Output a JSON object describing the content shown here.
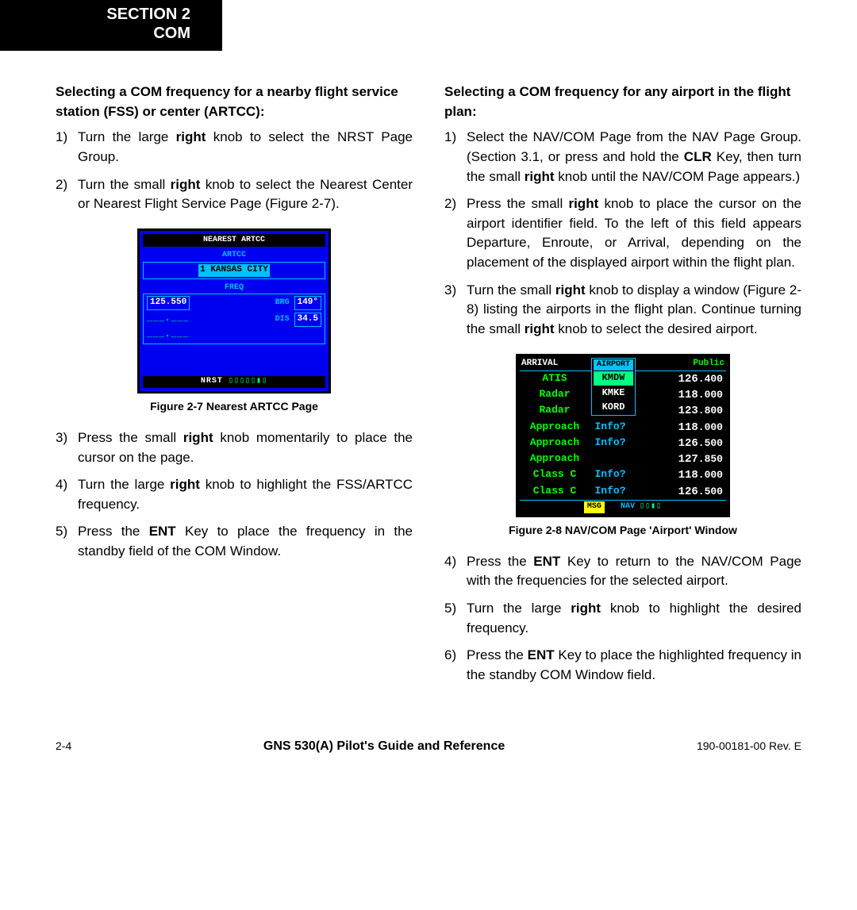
{
  "header": {
    "line1": "SECTION 2",
    "line2": "COM"
  },
  "left": {
    "heading": "Selecting a COM frequency for a nearby flight service station (FSS) or center (ARTCC):",
    "steps1": [
      {
        "n": "1)",
        "t": "Turn the large <b>right</b> knob to select the NRST Page Group."
      },
      {
        "n": "2)",
        "t": "Turn the small <b>right</b> knob to select the Nearest Center or Nearest Flight Service Page (Figure 2-7)."
      }
    ],
    "fig1": {
      "title": "NEAREST ARTCC",
      "artcc_label": "ARTCC",
      "artcc_line": "1 KANSAS CITY",
      "freq_label": "FREQ",
      "freq": "125.550",
      "brg_label": "BRG",
      "brg": "149°",
      "dis_label": "DIS",
      "dis": "34.5",
      "bottom": "NRST",
      "caption": "Figure 2-7  Nearest ARTCC Page"
    },
    "steps2": [
      {
        "n": "3)",
        "t": "Press the small <b>right</b> knob momentarily to place the cursor on the page."
      },
      {
        "n": "4)",
        "t": "Turn the large <b>right</b> knob to highlight the FSS/ARTCC frequency."
      },
      {
        "n": "5)",
        "t": "Press the <b>ENT</b> Key to place the frequency in the standby field of the COM Window."
      }
    ]
  },
  "right": {
    "heading": "Selecting a COM frequency for any airport in the flight plan:",
    "steps1": [
      {
        "n": "1)",
        "t": "Select the NAV/COM Page from the NAV Page Group.  (Section 3.1, or press and hold the <b>CLR</b> Key, then turn the small <b>right</b> knob until the NAV/COM Page appears.)"
      },
      {
        "n": "2)",
        "t": "Press the small <b>right</b> knob to place the cursor on the airport identifier field.  To the left of this field appears Departure, Enroute, or Arrival, depending on the placement of the displayed airport within the flight plan."
      },
      {
        "n": "3)",
        "t": "Turn the small <b>right</b> knob to display a window (Figure 2-8) listing the airports in the flight plan.  Continue turning the small <b>right</b> knob to select the desired airport."
      }
    ],
    "fig2": {
      "arrival": "ARRIVAL",
      "public": "Public",
      "popup_title": "AIRPORT",
      "popup": [
        "KMDW",
        "KMKE",
        "KORD"
      ],
      "rows": [
        {
          "name": "ATIS",
          "info": "",
          "freq": "126.400"
        },
        {
          "name": "Radar",
          "info": "",
          "freq": "118.000"
        },
        {
          "name": "Radar",
          "info": "",
          "freq": "123.800"
        },
        {
          "name": "Approach",
          "info": "Info?",
          "freq": "118.000"
        },
        {
          "name": "Approach",
          "info": "Info?",
          "freq": "126.500"
        },
        {
          "name": "Approach",
          "info": "",
          "freq": "127.850"
        },
        {
          "name": "Class C",
          "info": "Info?",
          "freq": "118.000"
        },
        {
          "name": "Class C",
          "info": "Info?",
          "freq": "126.500"
        }
      ],
      "msg": "MSG",
      "nav": "NAV",
      "caption": "Figure 2-8  NAV/COM Page 'Airport' Window"
    },
    "steps2": [
      {
        "n": "4)",
        "t": "Press the <b>ENT</b> Key to return to the NAV/COM Page with the frequencies for the selected airport."
      },
      {
        "n": "5)",
        "t": "Turn the large <b>right</b> knob to highlight the desired frequency."
      },
      {
        "n": "6)",
        "t": "Press the <b>ENT</b> Key to place the highlighted frequency in the standby COM Window field."
      }
    ]
  },
  "footer": {
    "page": "2-4",
    "center": "GNS 530(A) Pilot's Guide and Reference",
    "right": "190-00181-00  Rev. E"
  }
}
